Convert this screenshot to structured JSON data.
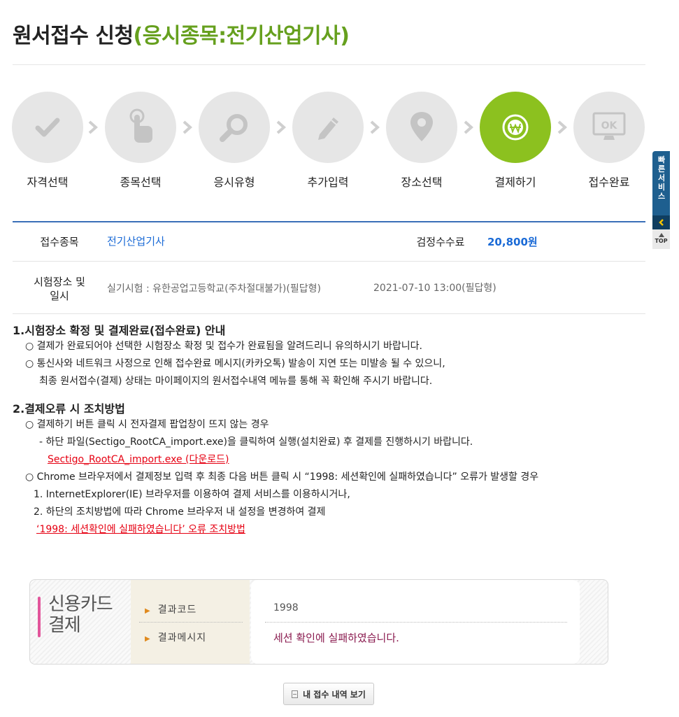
{
  "page": {
    "title_main": "원서접수 신청",
    "title_highlight": "(응시종목:전기산업기사)"
  },
  "steps": [
    {
      "label": "자격선택",
      "icon": "check-icon",
      "active": false
    },
    {
      "label": "종목선택",
      "icon": "touch-hand-icon",
      "active": false
    },
    {
      "label": "응시유형",
      "icon": "magnifier-icon",
      "active": false
    },
    {
      "label": "추가입력",
      "icon": "pencil-icon",
      "active": false
    },
    {
      "label": "장소선택",
      "icon": "location-pin-icon",
      "active": false
    },
    {
      "label": "결제하기",
      "icon": "won-coin-icon",
      "active": true
    },
    {
      "label": "접수완료",
      "icon": "ok-monitor-icon",
      "active": false
    }
  ],
  "info": {
    "subject_label": "접수종목",
    "subject_value": "전기산업기사",
    "fee_label": "검정수수료",
    "fee_value": "20,800원",
    "place_label": "시험장소 및 일시",
    "place_value": "실기시험 : 유한공업고등학교(주차절대불가)(필답형)",
    "datetime_value": "2021-07-10 13:00(필답형)"
  },
  "notice1": {
    "title": "1.시험장소 확정 및 결제완료(접수완료) 안내",
    "line1": "○ 결제가 완료되어야 선택한 시험장소 확정 및 접수가 완료됨을 알려드리니 유의하시기 바랍니다.",
    "line2": "○ 통신사와 네트워크 사정으로 인해 접수완료 메시지(카카오톡) 발송이 지연 또는 미발송 될 수 있으니,",
    "line3": "최종 원서접수(결제) 상태는 마이페이지의 원서접수내역 메뉴를 통해 꼭 확인해 주시기 바랍니다."
  },
  "notice2": {
    "title": "2.결제오류 시 조치방법",
    "line1": "○ 결제하기 버튼 클릭 시 전자결제 팝업창이 뜨지 않는 경우",
    "line2": "- 하단 파일(Sectigo_RootCA_import.exe)을 클릭하여 실행(설치완료) 후 결제를 진행하시기 바랍니다.",
    "download_link": "Sectigo_RootCA_import.exe (다운로드)",
    "line3": "○ Chrome 브라우저에서 결제정보 입력 후 최종 다음 버튼 클릭 시 “1998: 세션확인에 실패하였습니다” 오류가 발생할 경우",
    "line4": "1. InternetExplorer(IE) 브라우저를 이용하여 결제 서비스를 이용하시거나,",
    "line5": "2. 하단의 조치방법에 따라 Chrome 브라우저 내 설정을 변경하여 결제",
    "fix_link": "‘1998: 세션확인에 실패하였습니다’ 오류 조치방법"
  },
  "result": {
    "title_line1": "신용카드",
    "title_line2": "결제",
    "code_label": "결과코드",
    "code_value": "1998",
    "message_label": "결과메시지",
    "message_value": "세션 확인에 실패하였습니다."
  },
  "buttons": {
    "my_history": "내 접수 내역 보기"
  },
  "quick": {
    "label": "빠른서비스",
    "top": "TOP"
  },
  "colors": {
    "accent_green": "#8cc11f",
    "title_green": "#66a01e",
    "link_blue": "#1a6ad6",
    "error_red": "#e60012",
    "message_purple": "#8a1b4f"
  }
}
